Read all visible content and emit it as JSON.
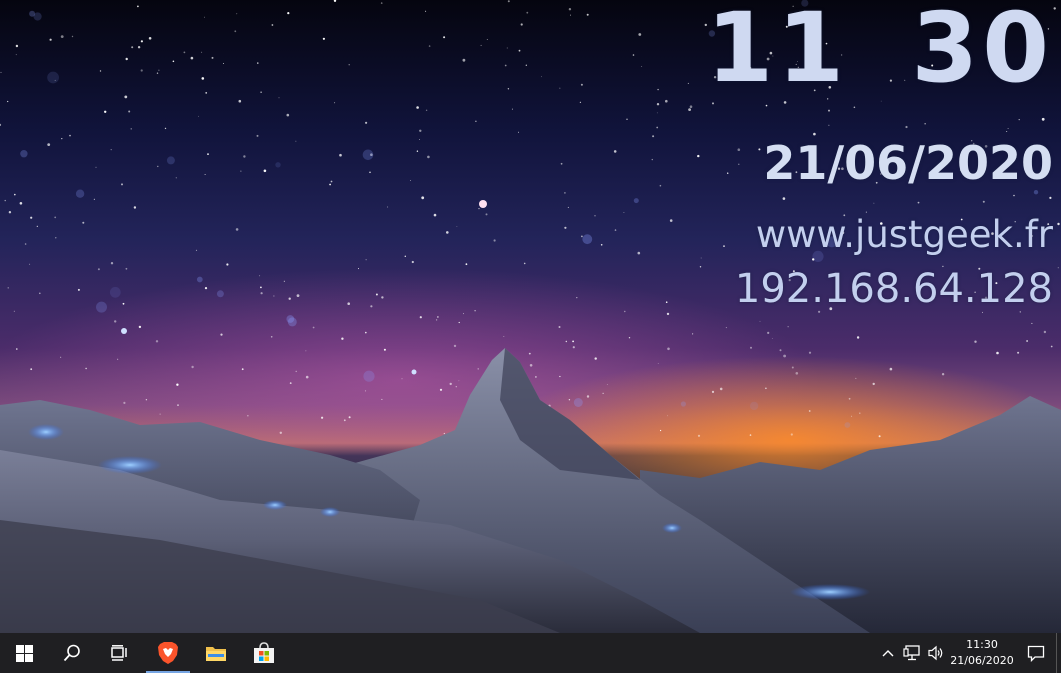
{
  "wallpaper": {
    "clock_time": "11 30",
    "clock_date": "21/06/2020",
    "site_url": "www.justgeek.fr",
    "ip_address": "192.168.64.128"
  },
  "taskbar": {
    "start_icon": "windows-logo-icon",
    "search_icon": "search-icon",
    "task_view_icon": "task-view-icon",
    "pinned_apps": [
      {
        "icon": "brave-browser-icon",
        "active": true
      },
      {
        "icon": "file-explorer-icon",
        "active": false
      },
      {
        "icon": "microsoft-store-icon",
        "active": false
      }
    ],
    "tray": {
      "chevron_icon": "chevron-up-icon",
      "network_icon": "network-icon",
      "volume_icon": "volume-icon",
      "time": "11:30",
      "date": "21/06/2020",
      "notification_icon": "notification-icon"
    }
  },
  "colors": {
    "taskbar_bg": "#1f1f22",
    "active_indicator": "#76a5e3",
    "overlay_text": "#c6d2ee"
  }
}
